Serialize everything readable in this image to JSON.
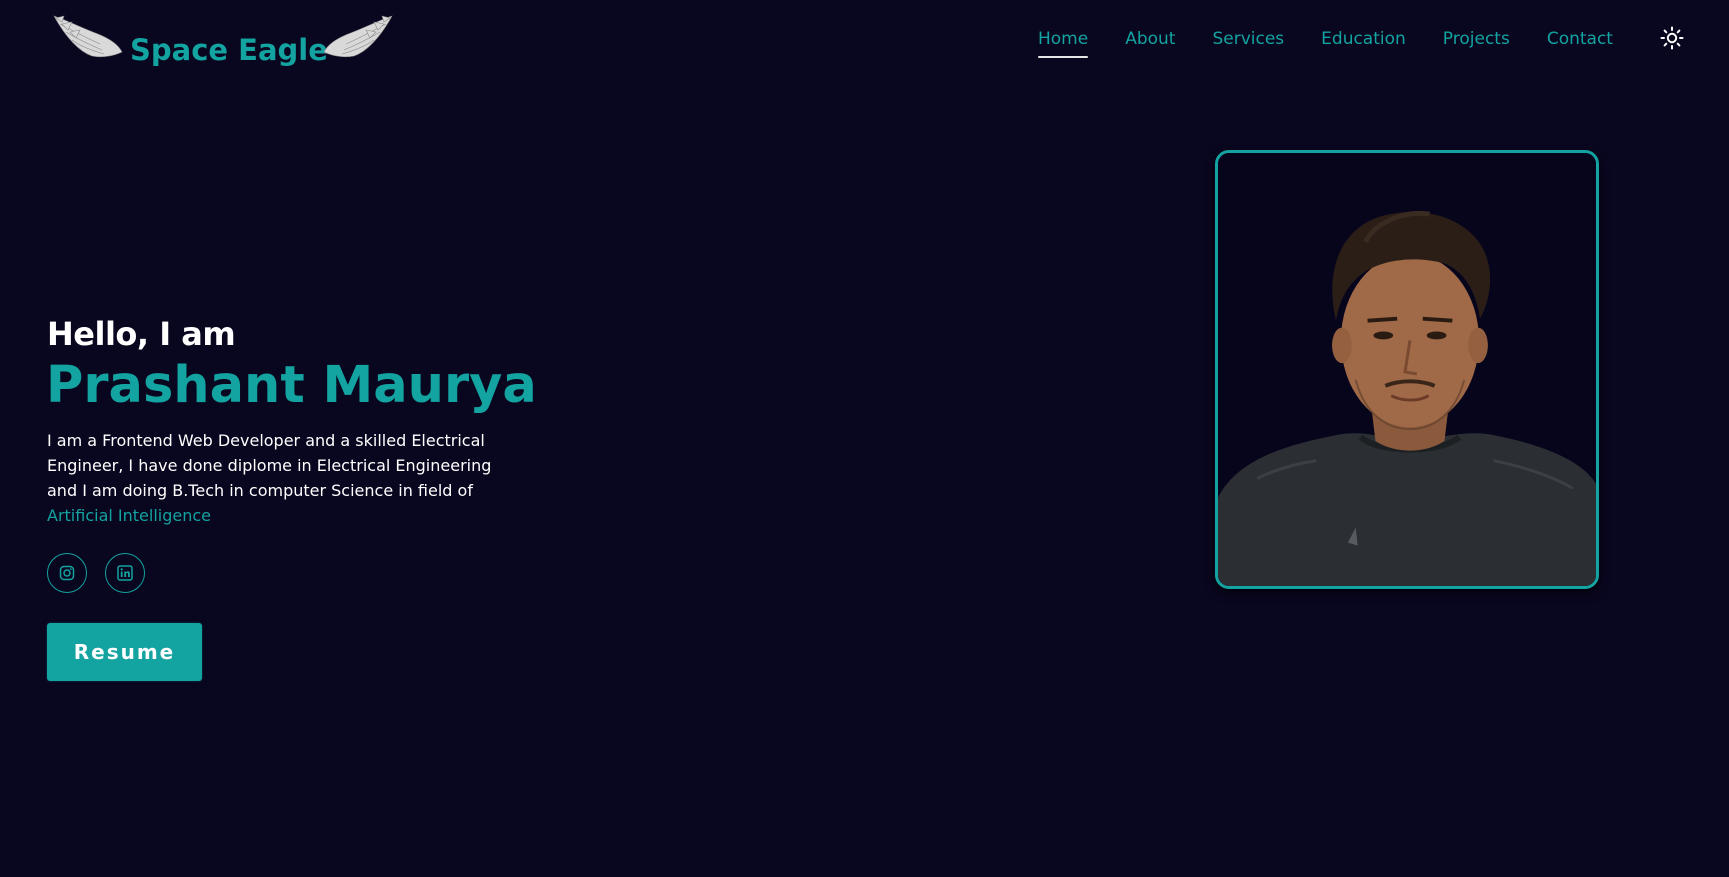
{
  "brand": {
    "name": "Space Eagle",
    "logo_icon": "eagle-wings-icon",
    "accent_color": "#13a3a0",
    "background_color": "#09061f"
  },
  "nav": {
    "items": [
      {
        "label": "Home",
        "active": true
      },
      {
        "label": "About",
        "active": false
      },
      {
        "label": "Services",
        "active": false
      },
      {
        "label": "Education",
        "active": false
      },
      {
        "label": "Projects",
        "active": false
      },
      {
        "label": "Contact",
        "active": false
      }
    ],
    "theme_toggle_icon": "sun-icon"
  },
  "hero": {
    "greeting": "Hello, I am",
    "name": "Prashant Maurya",
    "bio_lines": [
      "I am a Frontend Web Developer and a skilled Electrical",
      "Engineer, I have done diplome in Electrical Engineering",
      "and I am doing B.Tech in computer Science in field of"
    ],
    "bio_highlight": "Artificial Intelligence",
    "socials": [
      {
        "icon": "instagram-icon"
      },
      {
        "icon": "linkedin-icon"
      }
    ],
    "resume_label": "Resume"
  },
  "profile": {
    "image_icon": "profile-photo"
  }
}
